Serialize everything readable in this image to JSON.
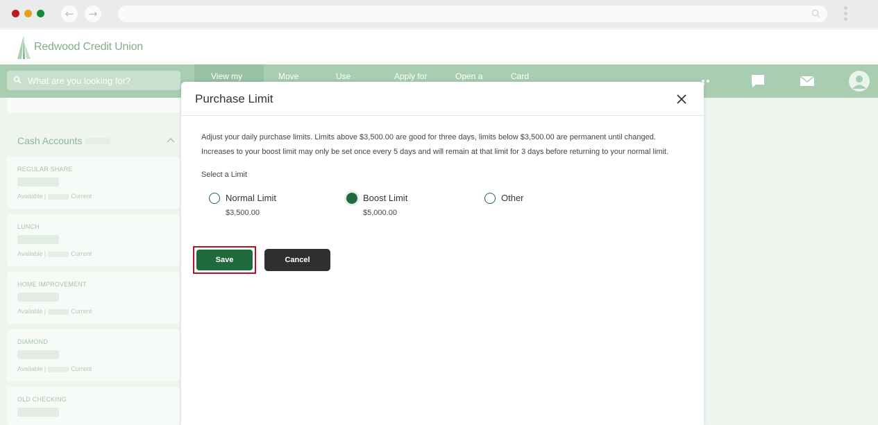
{
  "browser": {
    "dot_colors": [
      "#c0181b",
      "#e3a21a",
      "#138a36"
    ],
    "back_icon": "arrow-left-icon",
    "forward_icon": "arrow-right-icon",
    "url": ""
  },
  "header": {
    "logo_text": "Redwood Credit Union",
    "brand_color": "#1f6b3d"
  },
  "nav": {
    "search_placeholder": "What are you looking for?",
    "items": [
      "View my",
      "Move",
      "Use",
      "Apply for",
      "Open a",
      "Card"
    ],
    "active_index": 0
  },
  "sidebar": {
    "section_title": "Cash Accounts",
    "accounts": [
      {
        "name": "REGULAR SHARE",
        "available_label": "Available",
        "current_label": "Current"
      },
      {
        "name": "LUNCH",
        "available_label": "Available",
        "current_label": "Current"
      },
      {
        "name": "HOME IMPROVEMENT",
        "available_label": "Available",
        "current_label": "Current"
      },
      {
        "name": "DIAMOND",
        "available_label": "Available",
        "current_label": "Current"
      },
      {
        "name": "OLD CHECKING",
        "available_label": "Available",
        "current_label": "Current"
      }
    ]
  },
  "modal": {
    "title": "Purchase Limit",
    "description_line1": "Adjust your daily purchase limits. Limits above $3,500.00 are good for three days, limits below $3,500.00 are permanent until changed.",
    "description_line2": "Increases to your boost limit may only be set once every 5 days and will remain at that limit for 3 days before returning to your normal limit.",
    "select_label": "Select a Limit",
    "options": [
      {
        "label": "Normal Limit",
        "amount": "$3,500.00",
        "selected": false
      },
      {
        "label": "Boost Limit",
        "amount": "$5,000.00",
        "selected": true
      },
      {
        "label": "Other",
        "amount": "",
        "selected": false
      }
    ],
    "save_label": "Save",
    "cancel_label": "Cancel"
  }
}
